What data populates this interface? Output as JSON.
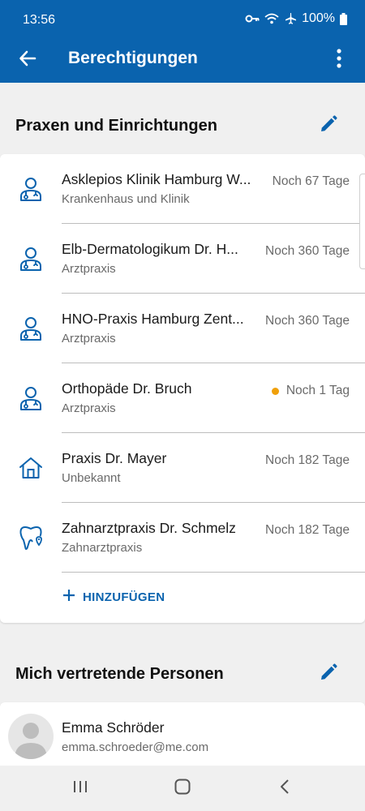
{
  "status_bar": {
    "time": "13:56",
    "battery": "100%",
    "icons": [
      "key-icon",
      "wifi-icon",
      "airplane-icon",
      "battery-icon"
    ]
  },
  "app_bar": {
    "title": "Berechtigungen",
    "back_icon": "arrow-back-icon",
    "menu_icon": "more-vert-icon"
  },
  "colors": {
    "primary": "#0a63ae",
    "warning_dot": "#f0a00a",
    "background": "#f0f0f0"
  },
  "praxen": {
    "title": "Praxen und Einrichtungen",
    "items": [
      {
        "name": "Asklepios Klinik Hamburg W...",
        "type": "Krankenhaus und Klinik",
        "remaining": "Noch 67 Tage",
        "icon": "doctor-icon",
        "warning": false
      },
      {
        "name": "Elb-Dermatologikum Dr. H...",
        "type": "Arztpraxis",
        "remaining": "Noch 360 Tage",
        "icon": "doctor-icon",
        "warning": false
      },
      {
        "name": "HNO-Praxis Hamburg Zent...",
        "type": "Arztpraxis",
        "remaining": "Noch 360 Tage",
        "icon": "doctor-icon",
        "warning": false
      },
      {
        "name": "Orthopäde Dr. Bruch",
        "type": "Arztpraxis",
        "remaining": "Noch 1 Tag",
        "icon": "doctor-icon",
        "warning": true
      },
      {
        "name": "Praxis Dr. Mayer",
        "type": "Unbekannt",
        "remaining": "Noch 182 Tage",
        "icon": "house-icon",
        "warning": false
      },
      {
        "name": "Zahnarztpraxis Dr. Schmelz",
        "type": "Zahnarztpraxis",
        "remaining": "Noch 182 Tage",
        "icon": "tooth-icon",
        "warning": false
      }
    ],
    "add_label": "HINZUFÜGEN"
  },
  "vertreter": {
    "title": "Mich vertretende Personen",
    "items": [
      {
        "name": "Emma Schröder",
        "email": "emma.schroeder@me.com"
      }
    ]
  }
}
